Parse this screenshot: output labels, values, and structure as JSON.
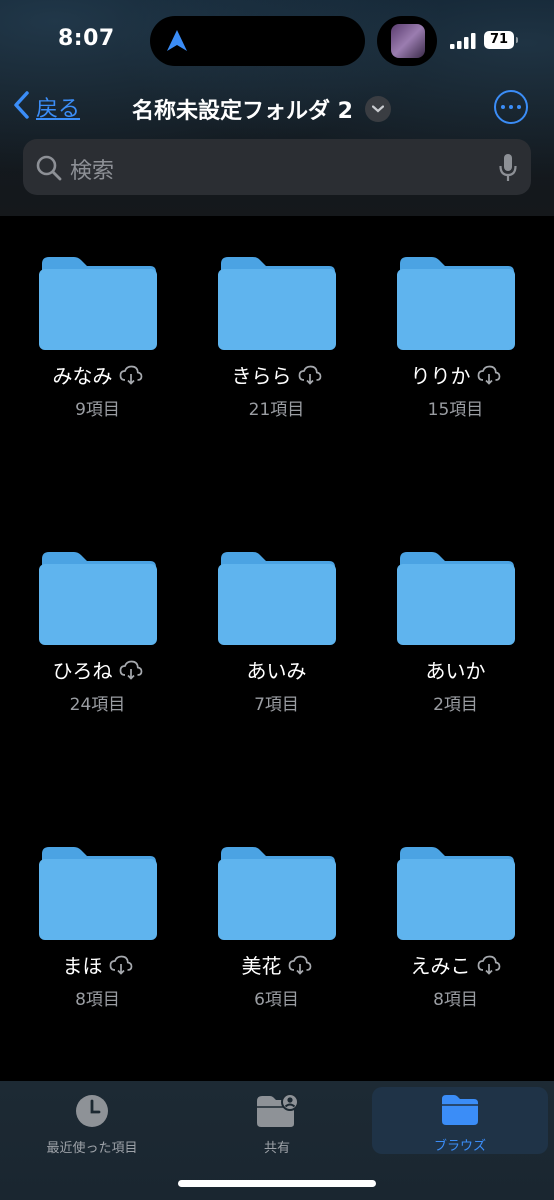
{
  "status_bar": {
    "time": "8:07",
    "battery": "71"
  },
  "nav": {
    "back_label": "戻る",
    "title": "名称未設定フォルダ 2"
  },
  "search": {
    "placeholder": "検索"
  },
  "folders": [
    {
      "name": "みなみ",
      "count": "9項目"
    },
    {
      "name": "きらら",
      "count": "21項目"
    },
    {
      "name": "りりか",
      "count": "15項目"
    },
    {
      "name": "ひろね",
      "count": "24項目"
    },
    {
      "name": "あいみ",
      "count": "7項目"
    },
    {
      "name": "あいか",
      "count": "2項目"
    },
    {
      "name": "まほ",
      "count": "8項目"
    },
    {
      "name": "美花",
      "count": "6項目"
    },
    {
      "name": "えみこ",
      "count": "8項目"
    }
  ],
  "tabs": [
    {
      "label": "最近使った項目",
      "icon": "clock-icon"
    },
    {
      "label": "共有",
      "icon": "shared-folder-icon"
    },
    {
      "label": "ブラウズ",
      "icon": "folder-icon"
    }
  ],
  "colors": {
    "accent": "#3b8df7",
    "folder": "#5aaeea"
  }
}
